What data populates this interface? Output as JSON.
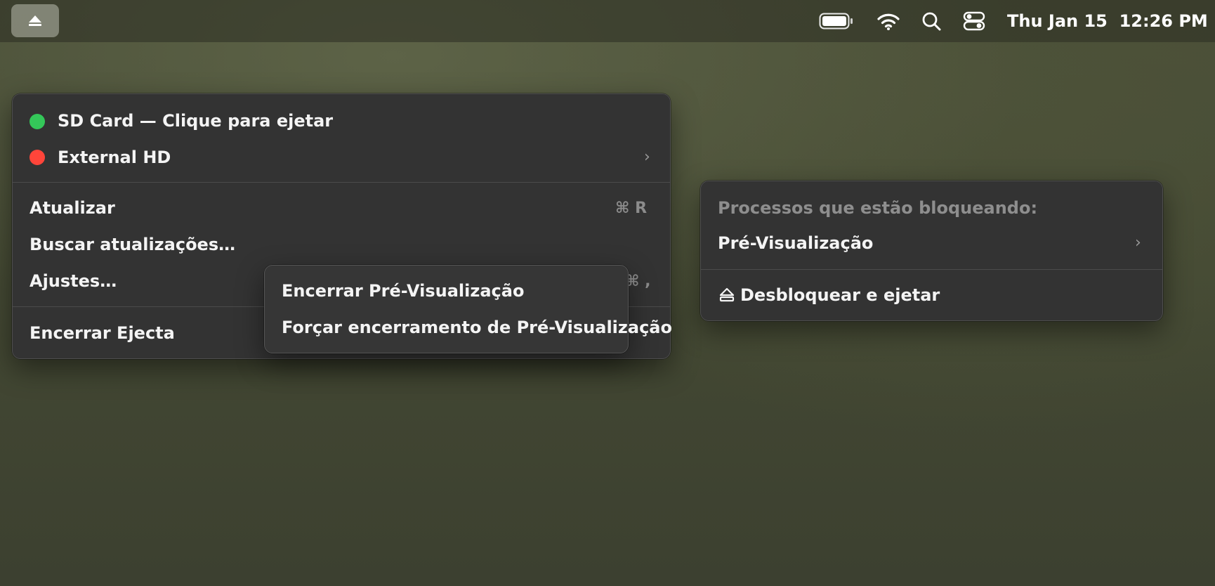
{
  "menubar": {
    "clock": "Thu Jan 15  12:26 PM",
    "icons": [
      "eject-icon",
      "battery-icon",
      "wifi-icon",
      "search-icon",
      "control-center-icon"
    ]
  },
  "main_menu": {
    "volumes": [
      {
        "label": "SD Card — Clique para ejetar",
        "status_color": "#34c759"
      },
      {
        "label": "External HD",
        "status_color": "#ff453a"
      }
    ],
    "refresh_label": "Atualizar",
    "refresh_shortcut": "⌘ R",
    "check_updates_label": "Buscar atualizações…",
    "settings_label": "Ajustes…",
    "settings_shortcut": "⌘ ,",
    "quit_label": "Encerrar Ejecta"
  },
  "app_submenu": {
    "quit_label": "Encerrar Pré-Visualização",
    "force_quit_label": "Forçar encerramento de Pré-Visualização"
  },
  "blocking_menu": {
    "header": "Processos que estão bloqueando:",
    "process_label": "Pré-Visualização",
    "unlock_eject_label": "Desbloquear e ejetar"
  }
}
